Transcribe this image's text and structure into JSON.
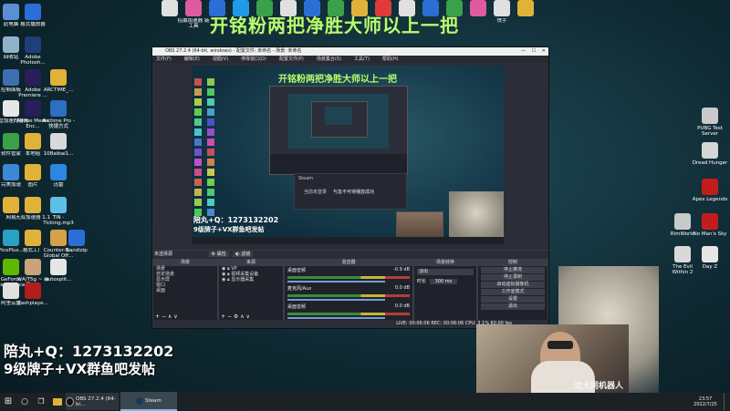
{
  "overlay": {
    "top_banner": "开铭粉两把净胜大师以上一把",
    "qq_line": "陪丸+Q：1273132202",
    "vx_line": "9级牌子+VX群鱼吧发帖",
    "preview_banner": "开铭粉两把净胜大师以上一把",
    "preview_qq": "陪丸+Q：1273132202",
    "preview_vx": "9级牌子+VX群鱼吧发帖"
  },
  "desktop_icons_left": [
    {
      "label": "此电脑",
      "color": "#5a8fd6"
    },
    {
      "label": "格式播放器",
      "color": "#2b6fd6"
    },
    {
      "label": "回收站",
      "color": "#8fb4c9"
    },
    {
      "label": "Adobe Photosh...",
      "color": "#1d3f7a"
    },
    {
      "label": "控制面板",
      "color": "#3d6fb0"
    },
    {
      "label": "Adobe Premiere ...",
      "color": "#2a1d5c"
    },
    {
      "label": "ARCTIME_...",
      "color": "#e0b23a"
    },
    {
      "label": "运营加速的服务",
      "color": "#e6e6e6"
    },
    {
      "label": "Adobe Media Enc...",
      "color": "#2a1d5c"
    },
    {
      "label": "Arctime Pro - 快捷方式",
      "color": "#2d6fc0"
    },
    {
      "label": "软件管家",
      "color": "#3aa14a"
    },
    {
      "label": "本地组",
      "color": "#e0b23a"
    },
    {
      "label": "10Baibai1...",
      "color": "#d9d9d9"
    },
    {
      "label": "完美加速",
      "color": "#3d88d6"
    },
    {
      "label": "图片",
      "color": "#e0b23a"
    },
    {
      "label": "迅雷",
      "color": "#2d86e0"
    },
    {
      "label": "网易",
      "color": "#e0b23a"
    },
    {
      "label": "无双加速器 1.1",
      "color": "#e0b23a"
    },
    {
      "label": "TIN - Ticking.mp3",
      "color": "#5cc0e6"
    },
    {
      "label": "PicoPlus...",
      "color": "#29a0c6"
    },
    {
      "label": "格式工厂",
      "color": "#e0b23a"
    },
    {
      "label": "Counter-S... Global Off...",
      "color": "#d6a14a"
    },
    {
      "label": "Bandizip",
      "color": "#2b6fd6"
    },
    {
      "label": "GeForce Experience",
      "color": "#5fb800"
    },
    {
      "label": "X/A/T5g ~ 新序.jpg",
      "color": "#caa37a"
    },
    {
      "label": "autosplit...",
      "color": "#e6e6e6"
    },
    {
      "label": "阿里云盘",
      "color": "#e0e0e0"
    },
    {
      "label": "flashplaye...",
      "color": "#b31d1d"
    }
  ],
  "desktop_icons_top": [
    {
      "label": "",
      "color": "#e0e0e0"
    },
    {
      "label": "招募加速器 链工具",
      "color": "#e05aa0"
    },
    {
      "label": "",
      "color": "#2b6fd6"
    },
    {
      "label": "",
      "color": "#1f9ae6"
    },
    {
      "label": "",
      "color": "#3aa14a"
    },
    {
      "label": "",
      "color": "#e0e0e0"
    },
    {
      "label": "",
      "color": "#2b6fd6"
    },
    {
      "label": "",
      "color": "#3aa14a"
    },
    {
      "label": "",
      "color": "#e0b23a"
    },
    {
      "label": "",
      "color": "#e03a3a"
    },
    {
      "label": "",
      "color": "#e0e0e0"
    },
    {
      "label": "",
      "color": "#2b6fd6"
    },
    {
      "label": "",
      "color": "#3aa14a"
    },
    {
      "label": "",
      "color": "#e05aa0"
    },
    {
      "label": "快手",
      "color": "#e0e0e0"
    },
    {
      "label": "",
      "color": "#e0b23a"
    }
  ],
  "desktop_icons_right": [
    {
      "label": "PUBG Test Server",
      "color": "#c9c9c9"
    },
    {
      "label": "Dread Hunger",
      "color": "#d6d6d6"
    },
    {
      "label": "Apex Legends",
      "color": "#c21d1d"
    },
    {
      "label": "RimWorld",
      "color": "#c9c9c9"
    },
    {
      "label": "No Man's Sky",
      "color": "#c21d1d"
    },
    {
      "label": "The Evil Within 2",
      "color": "#d9d9d9"
    },
    {
      "label": "Day Z",
      "color": "#e6e6e6"
    }
  ],
  "obs": {
    "title": "OBS 27.2.4 (64-bit, windows) - 配置文件: 未命名 - 场景: 未命名",
    "menu": [
      "文件(F)",
      "编辑(E)",
      "视图(V)",
      "停靠窗口(D)",
      "配置文件(P)",
      "场景集合(S)",
      "工具(T)",
      "帮助(H)"
    ],
    "steam_popup_title": "Steam",
    "steam_popup_msg": "当前未登录",
    "steam_popup_msg2": "与急不可待播放成功",
    "context_label": "未选择源",
    "context_btns": [
      "属性",
      "滤镜"
    ],
    "scenes_header": "场景",
    "scenes": [
      "场景",
      "自定场景",
      "显示屏",
      "窗口",
      "桌面"
    ],
    "sources_header": "来源",
    "sources": [
      "VP",
      "视频采集设备",
      "显示器采集"
    ],
    "mixer_header": "混音器",
    "mixer_channels": [
      {
        "name": "桌面音频",
        "db": "-0.9 dB"
      },
      {
        "name": "麦克风/Aux",
        "db": "0.0 dB"
      },
      {
        "name": "桌面音频",
        "db": "0.0 dB"
      }
    ],
    "transitions_header": "场景转换",
    "transition_value": "淡出",
    "duration_label": "时长",
    "duration_value": "300 ms",
    "controls_header": "控制",
    "controls": [
      "停止推流",
      "停止录制",
      "启动虚拟摄像机",
      "工作室模式",
      "设置",
      "退出"
    ],
    "status": "LIVE: 00:06:06  REC: 00:06:06  CPU: 3.1%  60.00 fps"
  },
  "taskbar": {
    "items": [
      "OBS 27.2.4 (64-bi...",
      "Steam"
    ],
    "time": "23:57",
    "date": "2022/7/25"
  },
  "webcam": {
    "watermark": "沈大同机器人"
  }
}
